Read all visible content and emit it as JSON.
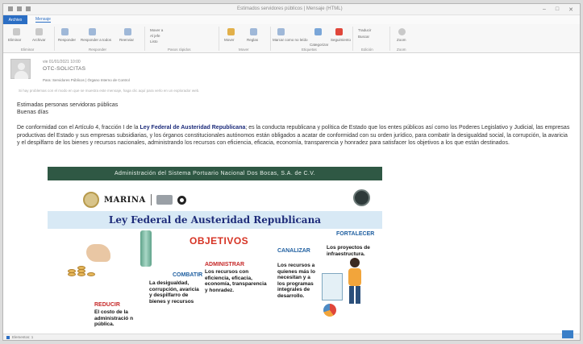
{
  "window": {
    "title": "Estimados servidores públicos | Mensaje (HTML)",
    "controls": [
      "–",
      "□",
      "✕"
    ]
  },
  "ribbon": {
    "file_tab": "Archivo",
    "message_tab": "Mensaje",
    "groups": [
      {
        "label": "Eliminar",
        "buttons": [
          "Eliminar",
          "Archivar"
        ]
      },
      {
        "label": "Responder",
        "buttons": [
          "Responder",
          "Responder a todos",
          "Reenviar"
        ]
      },
      {
        "label": "Pasos rápidos",
        "buttons": [
          "Mover a",
          "Al jefe",
          "Listo"
        ]
      },
      {
        "label": "Mover",
        "buttons": [
          "Mover",
          "Reglas"
        ]
      },
      {
        "label": "Etiquetas",
        "buttons": [
          "Marcar como no leído",
          "Categorizar",
          "Seguimiento"
        ]
      },
      {
        "label": "Edición",
        "buttons": [
          "Traducir",
          "Buscar"
        ]
      },
      {
        "label": "Zoom",
        "buttons": [
          "Zoom"
        ]
      }
    ]
  },
  "header": {
    "date": "vie 01/01/2021 10:00",
    "sender": "OTC-SOLICITAS",
    "to": "Para: Servidores Públicos | Órgano Interno de Control",
    "note": "Si hay problemas con el modo en que se muestra este mensaje, haga clic aquí para verlo en un explorador web."
  },
  "body": {
    "greeting1": "Estimadas personas servidoras públicas",
    "greeting2": "Buenas días",
    "para_before": "De conformidad con el Artículo 4, fracción I de la ",
    "law_name": "Ley Federal de Austeridad Republicana",
    "para_after": "; es la conducta republicana y política de Estado que los entes públicos así como los Poderes Legislativo y Judicial, las empresas productivas del Estado y sus empresas subsidiarias, y los órganos constitucionales autónomos están obligados a acatar de conformidad con su orden jurídico, para combatir la desigualdad social, la corrupción, la avaricia y el despilfarro de los bienes y recursos nacionales, administrando los recursos con eficiencia, eficacia, economía, transparencia y honradez para satisfacer los objetivos a los que están destinados."
  },
  "flyer": {
    "banner": "Administración del Sistema Portuario Nacional Dos Bocas, S.A. de C.V.",
    "marina": "MARINA",
    "title": "Ley Federal de Austeridad Republicana",
    "objetivos": "OBJETIVOS",
    "items": [
      {
        "head": "REDUCIR",
        "text": "El costo de la administració n pública."
      },
      {
        "head": "COMBATIR",
        "text": "La desigualdad, corrupción, avaricia y despilfarro de bienes y recursos"
      },
      {
        "head": "ADMINISTRAR",
        "text": "Los recursos con eficiencia, eficacia, economía, transparencia y honradez."
      },
      {
        "head": "CANALIZAR",
        "text": "Los recursos a quienes más lo necesitan y a los programas integrales de desarrollo."
      },
      {
        "head": "FORTALECER",
        "text": "Los proyectos de infraestructura."
      }
    ]
  },
  "statusbar": {
    "text": "Elementos: 1"
  },
  "colors": {
    "accent": "#2b6ec4",
    "banner_green": "#2f5844",
    "law_blue": "#1e2c7a",
    "objetivos_red": "#d63324"
  }
}
